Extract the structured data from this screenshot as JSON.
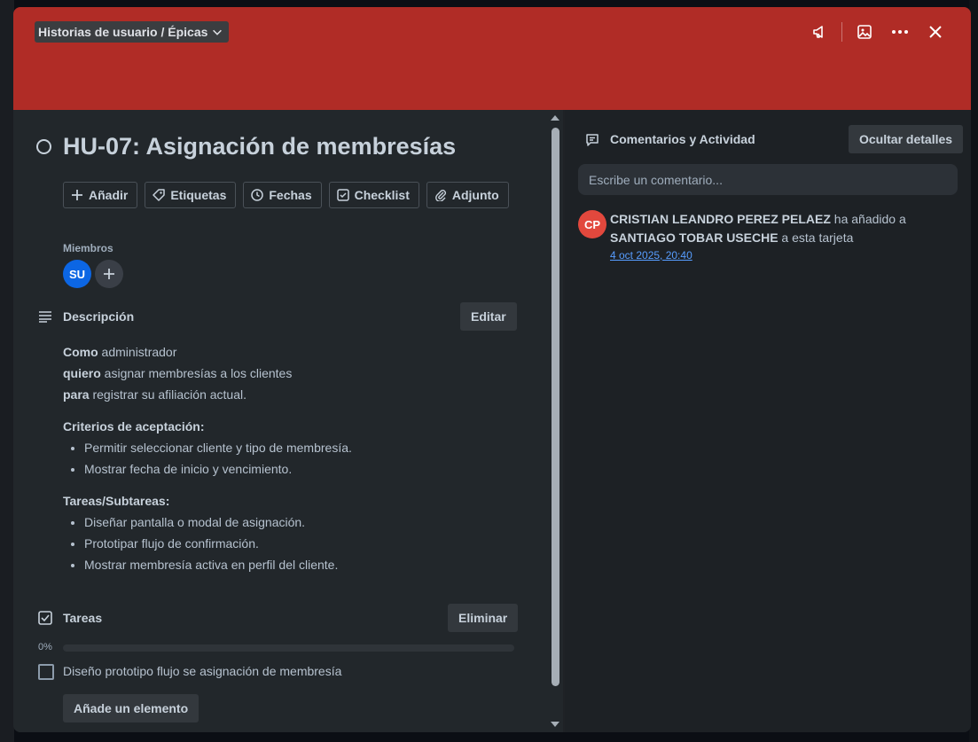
{
  "header": {
    "list_name": "Historias de usuario / Épicas",
    "icons": [
      "megaphone-icon",
      "image-icon",
      "more-icon",
      "close-icon"
    ]
  },
  "card": {
    "title": "HU-07: Asignación de membresías",
    "actions": [
      {
        "icon": "plus-icon",
        "label": "Añadir"
      },
      {
        "icon": "tag-icon",
        "label": "Etiquetas"
      },
      {
        "icon": "clock-icon",
        "label": "Fechas"
      },
      {
        "icon": "checklist-icon",
        "label": "Checklist"
      },
      {
        "icon": "paperclip-icon",
        "label": "Adjunto"
      }
    ],
    "members_label": "Miembros",
    "members": [
      {
        "initials": "SU",
        "color": "#0c66e4"
      }
    ]
  },
  "description": {
    "title": "Descripción",
    "edit_label": "Editar",
    "lines": [
      {
        "bold": "Como",
        "text": " administrador"
      },
      {
        "bold": "quiero",
        "text": " asignar membresías a los clientes"
      },
      {
        "bold": "para",
        "text": " registrar su afiliación actual."
      }
    ],
    "criteria_title": "Criterios de aceptación:",
    "criteria": [
      "Permitir seleccionar cliente y tipo de membresía.",
      "Mostrar fecha de inicio y vencimiento."
    ],
    "tasks_title": "Tareas/Subtareas:",
    "tasks": [
      "Diseñar pantalla o modal de asignación.",
      "Prototipar flujo de confirmación.",
      "Mostrar membresía activa en perfil del cliente."
    ]
  },
  "checklist": {
    "title": "Tareas",
    "delete_label": "Eliminar",
    "progress_label": "0%",
    "progress": 0,
    "items": [
      {
        "text": "Diseño prototipo flujo se asignación de membresía",
        "checked": false
      }
    ],
    "add_label": "Añade un elemento"
  },
  "activity": {
    "title": "Comentarios y Actividad",
    "hide_label": "Ocultar detalles",
    "comment_placeholder": "Escribe un comentario...",
    "entries": [
      {
        "initials": "CP",
        "avatar_color": "#e2483d",
        "actor": "CRISTIAN LEANDRO PEREZ PELAEZ",
        "verb": " ha añadido a ",
        "target": "SANTIAGO TOBAR USECHE",
        "rest": " a esta tarjeta",
        "time": "4 oct 2025, 20:40"
      }
    ]
  },
  "colors": {
    "cover": "#b02c26",
    "accent": "#579dff"
  }
}
